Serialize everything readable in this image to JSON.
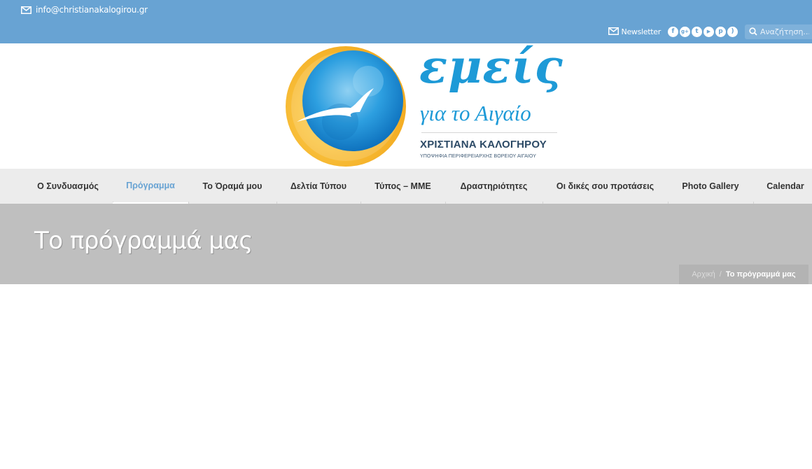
{
  "topbar": {
    "email": "info@christianakalogirou.gr",
    "newsletter_label": "Newsletter",
    "social_icons": [
      {
        "name": "facebook-icon",
        "glyph": "f"
      },
      {
        "name": "google-plus-icon",
        "glyph": "g+"
      },
      {
        "name": "twitter-icon",
        "glyph": "t"
      },
      {
        "name": "youtube-icon",
        "glyph": "▶"
      },
      {
        "name": "pinterest-icon",
        "glyph": "p"
      },
      {
        "name": "rss-icon",
        "glyph": ")"
      }
    ],
    "search_placeholder": "Αναζήτηση..."
  },
  "logo": {
    "title": "εμείς",
    "subtitle": "για το Αιγαίο",
    "name": "ΧΡΙΣΤΙΑΝΑ ΚΑΛΟΓΗΡΟΥ",
    "tagline": "ΥΠΟΨΗΦΙΑ ΠΕΡΙΦΕΡΕΙΑΡΧΗΣ ΒΟΡΕΙΟΥ ΑΙΓΑΙΟΥ"
  },
  "nav": {
    "items": [
      {
        "label": "Ο Συνδυασμός"
      },
      {
        "label": "Πρόγραμμα"
      },
      {
        "label": "Το Όραμά μου"
      },
      {
        "label": "Δελτία Τύπου"
      },
      {
        "label": "Τύπος – ΜΜΕ"
      },
      {
        "label": "Δραστηριότητες"
      },
      {
        "label": "Οι δικές σου προτάσεις"
      },
      {
        "label": "Photo Gallery"
      },
      {
        "label": "Calendar"
      }
    ]
  },
  "page": {
    "title": "Το πρόγραμμά μας",
    "breadcrumb": {
      "home": "Αρχική",
      "separator": "/",
      "current": "Το πρόγραμμά μας"
    }
  },
  "colors": {
    "topbar": "#68a3d3",
    "brand_blue": "#1e9ad7",
    "nav_background": "#ececec",
    "nav_active": "#68a3d3",
    "title_band": "#bfbfbf"
  }
}
